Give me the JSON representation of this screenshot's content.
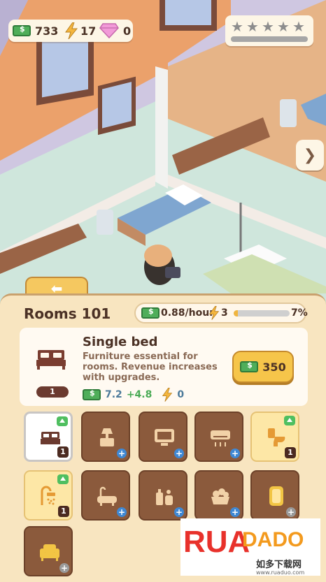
{
  "hud": {
    "cash": "733",
    "energy": "17",
    "gems": "0",
    "stars_filled": 0,
    "stars_total": 5,
    "star_progress": 0
  },
  "room": {
    "title": "Rooms 101",
    "income": "0.88/hour",
    "energy": "3",
    "progress_pct": "7%",
    "progress_value": 0.07
  },
  "selected_item": {
    "name": "Single bed",
    "description": "Furniture essential for rooms. Revenue increases with upgrades.",
    "level": "1",
    "income": "7.2",
    "income_bonus": "+4.8",
    "energy": "0",
    "price": "350"
  },
  "slots": [
    {
      "icon": "bed-icon",
      "state": "owned",
      "level": "1",
      "upgrade": true
    },
    {
      "icon": "nightstand-lamp-icon",
      "state": "locked"
    },
    {
      "icon": "tv-icon",
      "state": "locked"
    },
    {
      "icon": "air-conditioner-icon",
      "state": "locked"
    },
    {
      "icon": "toilet-icon",
      "state": "owned",
      "level": "1",
      "upgrade": true
    },
    {
      "icon": "shower-icon",
      "state": "owned",
      "level": "1",
      "upgrade": true
    },
    {
      "icon": "bathtub-icon",
      "state": "locked"
    },
    {
      "icon": "toiletries-icon",
      "state": "locked"
    },
    {
      "icon": "fruit-basket-icon",
      "state": "locked"
    },
    {
      "icon": "mirror-icon",
      "state": "locked_grey"
    },
    {
      "icon": "armchair-icon",
      "state": "locked_grey"
    }
  ],
  "watermark": {
    "brand": "RUADADO",
    "cn": "如多下载网",
    "url": "www.ruaduo.com"
  },
  "colors": {
    "panel_bg": "#f8e5c0",
    "slot_brown": "#8b5a3c",
    "slot_light": "#fde7a6",
    "button_gold": "#f6c54a",
    "cash_green": "#4fae5a"
  }
}
